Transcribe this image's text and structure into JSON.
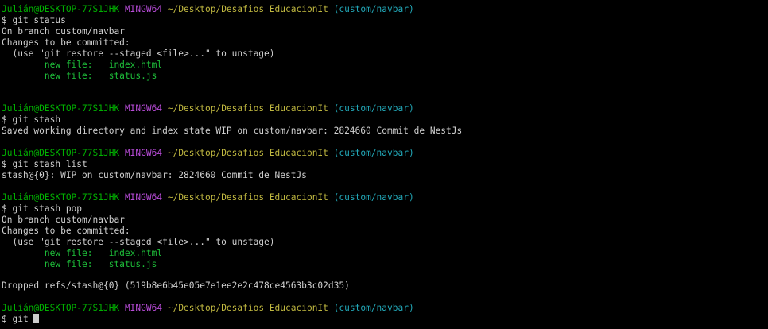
{
  "terminal": {
    "colors": {
      "background": "#000000",
      "text": "#cccccc",
      "user_host": "#00b000",
      "system": "#b84cd8",
      "path": "#c0b840",
      "branch": "#22a8b8",
      "staged_file": "#1ec03a"
    },
    "prompt": {
      "user_host": "Julián@DESKTOP-77S1JHK",
      "system": "MINGW64",
      "path": "~/Desktop/Desafios EducacionIt",
      "branch": "(custom/navbar)"
    },
    "lines": [
      {
        "type": "prompt"
      },
      {
        "type": "cmd",
        "text": "$ git status"
      },
      {
        "type": "out",
        "text": "On branch custom/navbar"
      },
      {
        "type": "out",
        "text": "Changes to be committed:"
      },
      {
        "type": "out",
        "text": "  (use \"git restore --staged <file>...\" to unstage)"
      },
      {
        "type": "file",
        "text": "        new file:   index.html"
      },
      {
        "type": "file",
        "text": "        new file:   status.js"
      },
      {
        "type": "blank"
      },
      {
        "type": "blank"
      },
      {
        "type": "prompt"
      },
      {
        "type": "cmd",
        "text": "$ git stash"
      },
      {
        "type": "out",
        "text": "Saved working directory and index state WIP on custom/navbar: 2824660 Commit de NestJs"
      },
      {
        "type": "blank"
      },
      {
        "type": "prompt"
      },
      {
        "type": "cmd",
        "text": "$ git stash list"
      },
      {
        "type": "out",
        "text": "stash@{0}: WIP on custom/navbar: 2824660 Commit de NestJs"
      },
      {
        "type": "blank"
      },
      {
        "type": "prompt"
      },
      {
        "type": "cmd",
        "text": "$ git stash pop"
      },
      {
        "type": "out",
        "text": "On branch custom/navbar"
      },
      {
        "type": "out",
        "text": "Changes to be committed:"
      },
      {
        "type": "out",
        "text": "  (use \"git restore --staged <file>...\" to unstage)"
      },
      {
        "type": "file",
        "text": "        new file:   index.html"
      },
      {
        "type": "file",
        "text": "        new file:   status.js"
      },
      {
        "type": "blank"
      },
      {
        "type": "out",
        "text": "Dropped refs/stash@{0} (519b8e6b45e05e7e1ee2e2c478ce4563b3c02d35)"
      },
      {
        "type": "blank"
      },
      {
        "type": "prompt"
      },
      {
        "type": "input",
        "text": "$ git"
      }
    ]
  }
}
